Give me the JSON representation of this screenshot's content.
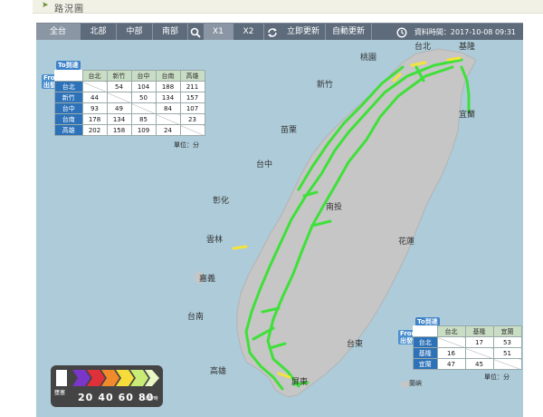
{
  "header": {
    "title": "路況圖"
  },
  "toolbar": {
    "tabs": [
      "全台",
      "北部",
      "中部",
      "南部"
    ],
    "search": "search",
    "zoom": [
      "X1",
      "X2"
    ],
    "refresh_now": "立即更新",
    "auto_refresh": "自動更新",
    "timestamp": "資料時間：2017-10-08 09:31"
  },
  "map_labels": {
    "keelung": "基隆",
    "taipei": "台北",
    "taoyuan": "桃園",
    "hsinchu": "新竹",
    "yilan": "宜蘭",
    "miaoli": "苗栗",
    "taichung": "台中",
    "changhua": "彰化",
    "nantou": "南投",
    "hualien": "花蓮",
    "yunlin": "雲林",
    "chiayi": "嘉義",
    "tainan": "台南",
    "taitung": "台東",
    "kaohsiung": "高雄",
    "pingtung": "屏東",
    "lanyu": "蘭嶼"
  },
  "west_table": {
    "to_label": "To到達",
    "from_label": "From出發",
    "columns": [
      "台北",
      "新竹",
      "台中",
      "台南",
      "高雄"
    ],
    "rows": [
      {
        "name": "台北",
        "values": [
          "",
          "54",
          "104",
          "188",
          "211"
        ]
      },
      {
        "name": "新竹",
        "values": [
          "44",
          "",
          "50",
          "134",
          "157"
        ]
      },
      {
        "name": "台中",
        "values": [
          "93",
          "49",
          "",
          "84",
          "107"
        ]
      },
      {
        "name": "台南",
        "values": [
          "178",
          "134",
          "85",
          "",
          "23"
        ]
      },
      {
        "name": "高雄",
        "values": [
          "202",
          "158",
          "109",
          "24",
          ""
        ]
      }
    ],
    "unit": "單位：分"
  },
  "east_table": {
    "to_label": "To到達",
    "from_label": "From出發",
    "columns": [
      "台北",
      "基隆",
      "宜蘭"
    ],
    "rows": [
      {
        "name": "台北",
        "values": [
          "",
          "17",
          "53"
        ]
      },
      {
        "name": "基隆",
        "values": [
          "16",
          "",
          "51"
        ]
      },
      {
        "name": "宜蘭",
        "values": [
          "47",
          "45",
          ""
        ]
      }
    ],
    "unit": "單位：分"
  },
  "legend": {
    "label": "壅塞",
    "speeds": [
      "20",
      "40",
      "60",
      "80"
    ],
    "unit": "公里/時",
    "colors": [
      "#ffffff",
      "#7a35c9",
      "#e0303a",
      "#f08a2a",
      "#f5dc3a",
      "#c8ec76",
      "#e8f7c4"
    ]
  },
  "colors": {
    "land": "#c6c6c6",
    "sea": "#adcbd9",
    "road_ok": "#3fe03a",
    "road_slow": "#f2e43b",
    "toolbar": "#5d6b7b"
  }
}
